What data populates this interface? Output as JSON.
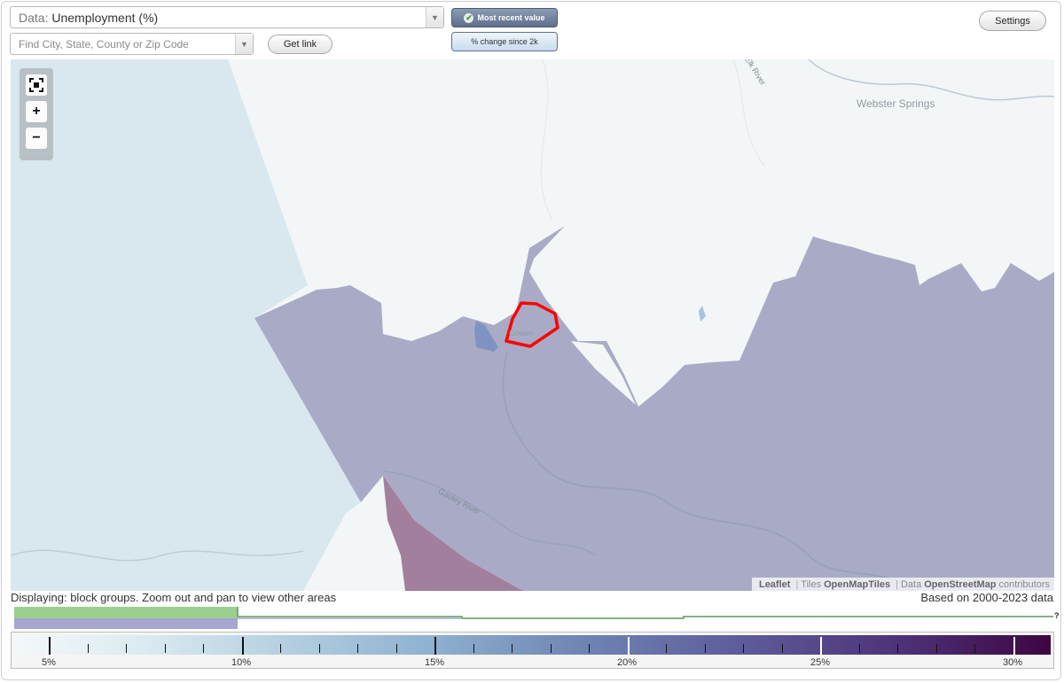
{
  "header": {
    "data_prefix": "Data:",
    "data_value": "Unemployment (%)",
    "search_placeholder": "Find City, State, County or Zip Code",
    "get_link_label": "Get link",
    "mode_active_label": "Most recent value",
    "mode_inactive_label": "% change since 2k",
    "settings_label": "Settings"
  },
  "map": {
    "place_labels": [
      "Webster Springs",
      "Cowen"
    ],
    "river_labels": [
      "Gauley River",
      "Elk River"
    ],
    "highlight_color": "#ff0000",
    "region_colors": {
      "low": "#d9e7ee",
      "mid": "#a9abc6",
      "high": "#a27f9c"
    },
    "zoom_in_label": "+",
    "zoom_out_label": "−",
    "attribution": {
      "leaflet": "Leaflet",
      "tiles_prefix": "Tiles",
      "tiles": "OpenMapTiles",
      "data_prefix": "Data",
      "data": "OpenStreetMap",
      "suffix": "contributors"
    }
  },
  "status": {
    "displaying": "Displaying: block groups. Zoom out and pan to view other areas",
    "based_on": "Based on 2000-2023 data"
  },
  "histogram": {
    "unknown_marker": "?",
    "colors": {
      "green": "#9ccf8f",
      "purple": "#a5a6d2",
      "line": "#5a9a5a"
    }
  },
  "legend": {
    "tick_labels": [
      "5%",
      "10%",
      "15%",
      "20%",
      "25%",
      "30%"
    ]
  }
}
